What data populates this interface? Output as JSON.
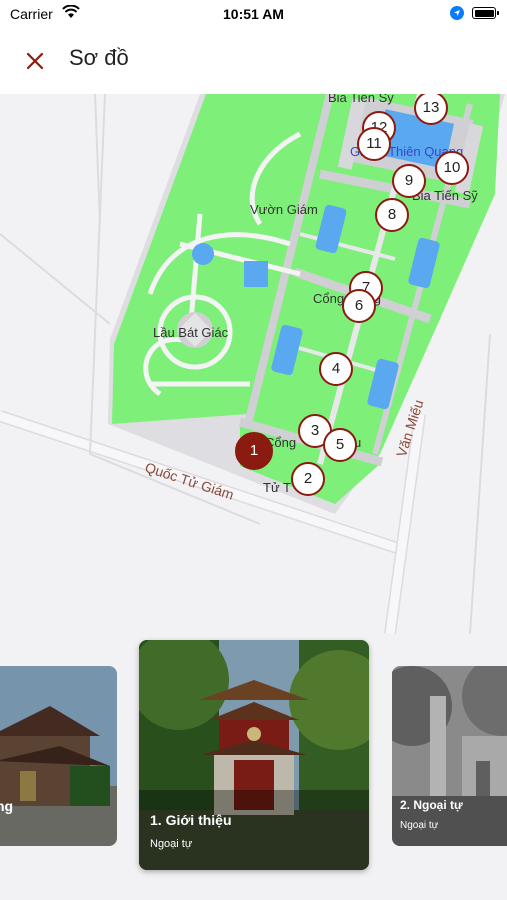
{
  "status_bar": {
    "carrier": "Carrier",
    "time": "10:51 AM"
  },
  "header": {
    "title": "Sơ đồ"
  },
  "map": {
    "labels": {
      "bia_top": "Bia Tiến Sỹ",
      "thien_quang": "Giếng Thiên Quang",
      "bia_right": "Bia Tiến Sỹ",
      "vuon_giam": "Vườn Giám",
      "cong_trung": "Cổng Trung",
      "lau_bat_giac": "Lầu Bát Giác",
      "cong_bottom": "Cổng",
      "cong_bottom_tail": "u",
      "quoc_tu_giam": "Quốc Tử Giám",
      "tu_t": "Tử T",
      "van_mieu": "Văn Miếu"
    },
    "pins": [
      "1",
      "2",
      "3",
      "4",
      "5",
      "6",
      "7",
      "8",
      "9",
      "10",
      "11",
      "12",
      "13"
    ],
    "active_pin": "1"
  },
  "cards": {
    "left": {
      "title": "ng"
    },
    "center": {
      "title": "1. Giới thiệu",
      "subtitle": "Ngoại tự"
    },
    "right": {
      "title": "2. Ngoại tự",
      "subtitle": "Ngoại tự"
    }
  },
  "colors": {
    "accent": "#8b1a10",
    "grass": "#7ef07a",
    "path": "#e8e8ea"
  }
}
